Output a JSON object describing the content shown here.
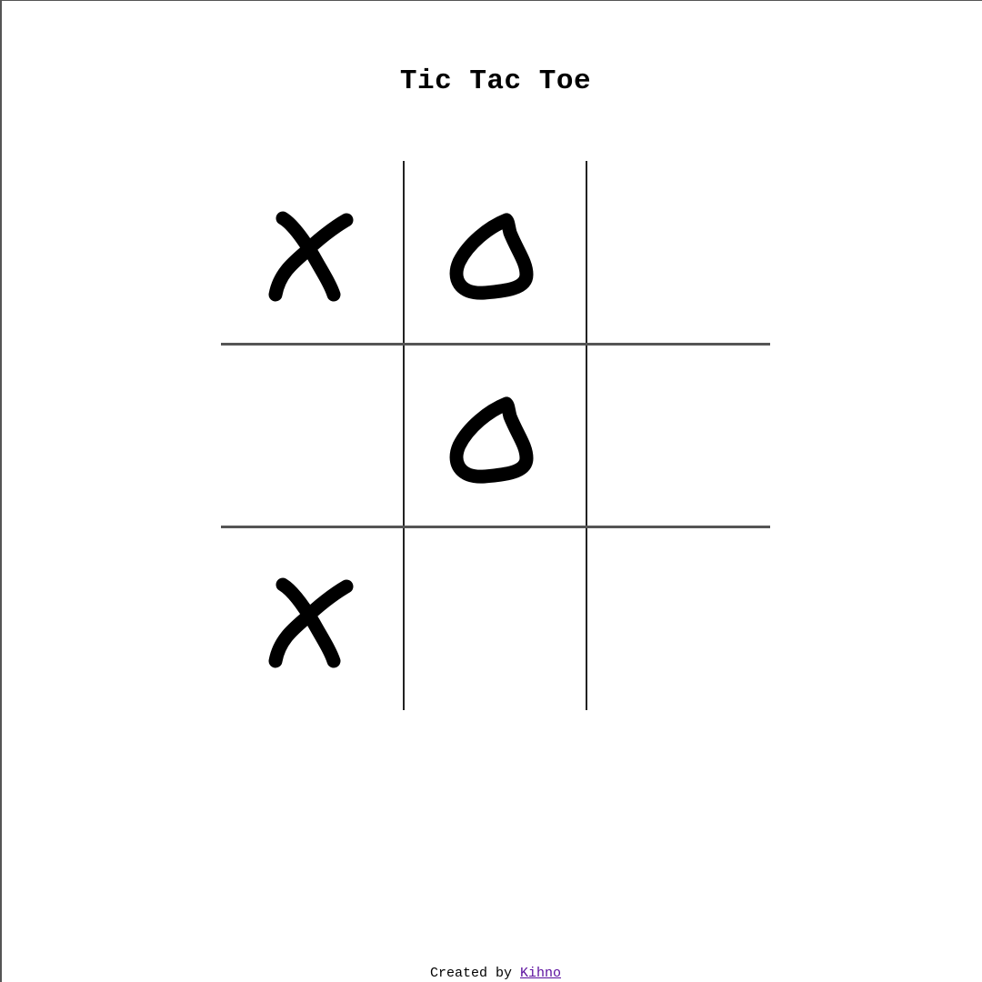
{
  "title": "Tic Tac Toe",
  "board": {
    "cells": [
      "X",
      "O",
      "",
      "",
      "O",
      "",
      "X",
      "",
      ""
    ]
  },
  "footer": {
    "prefix": "Created by",
    "author_link": "Kihno"
  },
  "colors": {
    "mark": "#000000",
    "link": "#5b0e9e",
    "grid": "#333333"
  }
}
